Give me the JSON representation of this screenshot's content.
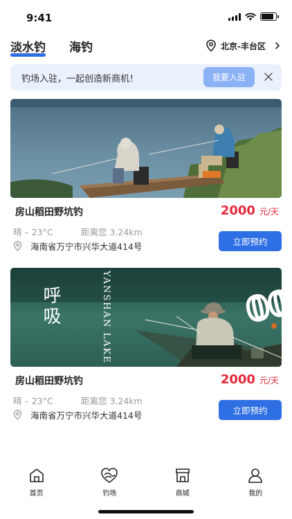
{
  "status": {
    "time": "9:41",
    "battery_level": 0.85
  },
  "header": {
    "tabs": [
      {
        "label": "淡水钓",
        "active": true
      },
      {
        "label": "海钓",
        "active": false
      }
    ],
    "location": "北京-丰台区"
  },
  "banner": {
    "text": "钓场入驻，一起创造新商机！",
    "button_label": "我要入驻"
  },
  "cards": [
    {
      "title": "房山稻田野坑钓",
      "price": "2000",
      "unit": "元/天",
      "weather": "晴 – 23°C",
      "distance": "距离您 3.24km",
      "address": "海南省万宁市兴华大道414号",
      "button_label": "立即预约",
      "image": "two anglers fishing at lakeside"
    },
    {
      "title": "房山稻田野坑钓",
      "price": "2000",
      "unit": "元/天",
      "weather": "晴 – 23°C",
      "distance": "距离您 3.24km",
      "address": "海南省万宁市兴华大道414号",
      "button_label": "立即预约",
      "image": "angler with hat fishing at green lake",
      "overlay_text_cn": "呼吸",
      "overlay_text_en": "YANSHAN LAKE",
      "overlay_number": "00"
    }
  ],
  "tabbar": [
    {
      "label": "首页",
      "icon": "home-icon"
    },
    {
      "label": "钓场",
      "icon": "fishing-spot-icon"
    },
    {
      "label": "商城",
      "icon": "shop-icon"
    },
    {
      "label": "我的",
      "icon": "profile-icon"
    }
  ],
  "colors": {
    "accent": "#2f6fe4",
    "price": "#e5283a",
    "banner_bg": "#eaf0fc",
    "banner_button": "#8cb2f6"
  }
}
